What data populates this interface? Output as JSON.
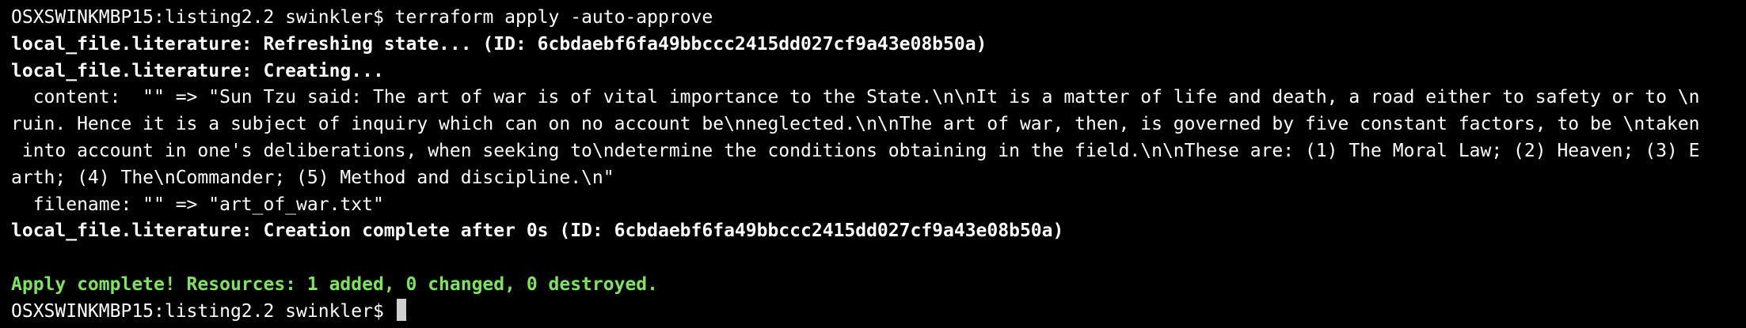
{
  "terminal": {
    "top_partial": "",
    "prompt": "OSXSWINKMBP15:listing2.2 swinkler$",
    "command": "terraform apply -auto-approve",
    "refreshing": "local_file.literature: Refreshing state... (ID: 6cbdaebf6fa49bbccc2415dd027cf9a43e08b50a)",
    "creating": "local_file.literature: Creating...",
    "content_line_1": "  content:  \"\" => \"Sun Tzu said: The art of war is of vital importance to the State.\\n\\nIt is a matter of life and death, a road either to safety or to \\n",
    "content_line_2": "ruin. Hence it is a subject of inquiry which can on no account be\\nneglected.\\n\\nThe art of war, then, is governed by five constant factors, to be \\ntaken",
    "content_line_3": " into account in one's deliberations, when seeking to\\ndetermine the conditions obtaining in the field.\\n\\nThese are: (1) The Moral Law; (2) Heaven; (3) E",
    "content_line_4": "arth; (4) The\\nCommander; (5) Method and discipline.\\n\"",
    "filename_line": "  filename: \"\" => \"art_of_war.txt\"",
    "complete": "local_file.literature: Creation complete after 0s (ID: 6cbdaebf6fa49bbccc2415dd027cf9a43e08b50a)",
    "apply_complete": "Apply complete! Resources: 1 added, 0 changed, 0 destroyed.",
    "final_prompt": "OSXSWINKMBP15:listing2.2 swinkler$ "
  },
  "colors": {
    "background": "#000000",
    "text": "#ffffff",
    "success": "#7ee35f",
    "cursor": "#cfcfcf"
  }
}
